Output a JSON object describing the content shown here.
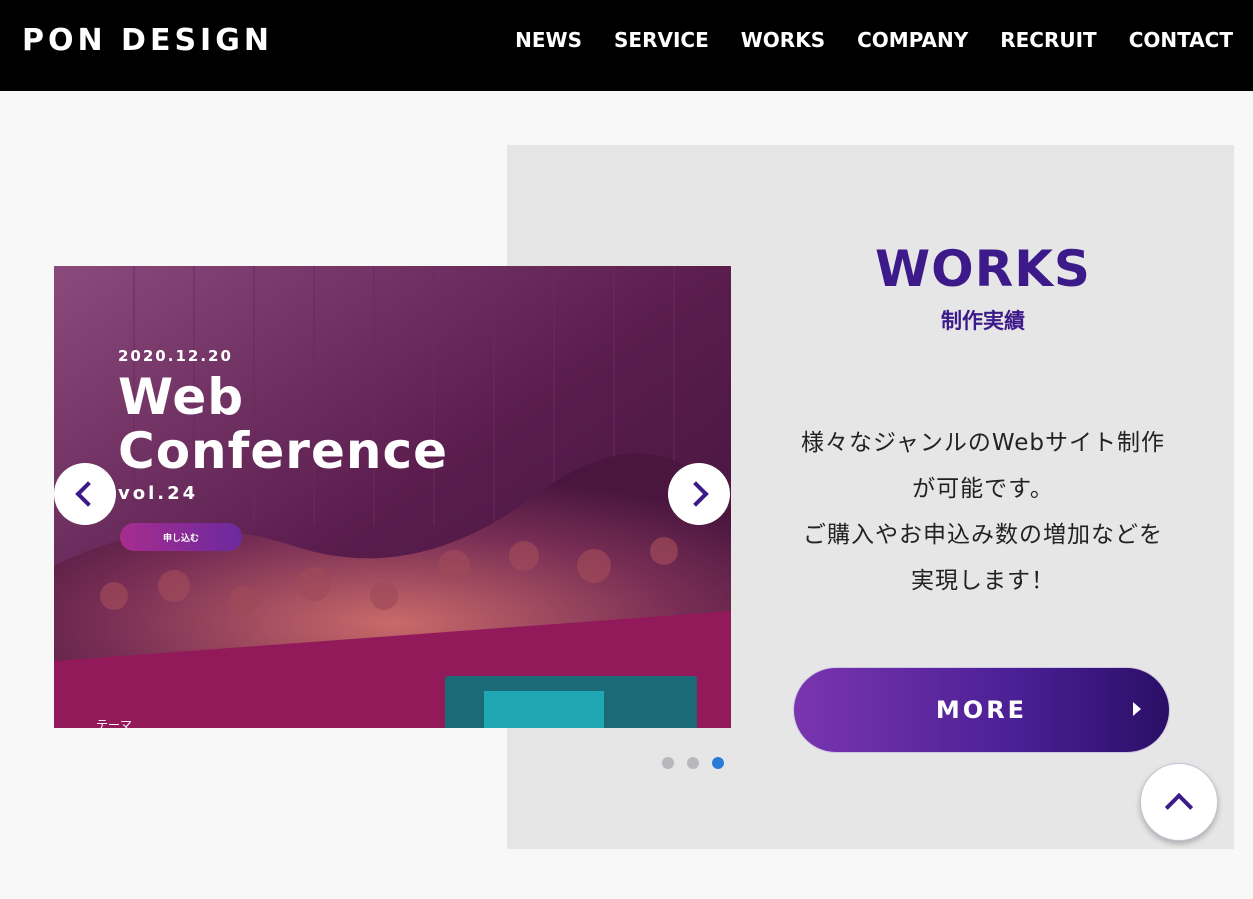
{
  "header": {
    "logo": "PON DESIGN",
    "nav": [
      "NEWS",
      "SERVICE",
      "WORKS",
      "COMPANY",
      "RECRUIT",
      "CONTACT"
    ]
  },
  "works": {
    "title": "WORKS",
    "subtitle": "制作実績",
    "desc_lines": [
      "様々なジャンルのWebサイト制作",
      "が可能です。",
      "ご購入やお申込み数の増加などを",
      "実現します！"
    ],
    "more_label": "MORE"
  },
  "slider": {
    "date": "2020.12.20",
    "title_lines": [
      "Web",
      "Conference"
    ],
    "vol": "vol.24",
    "apply_label": "申し込む",
    "theme_label": "テーマ",
    "dots_count": 3,
    "active_dot_index": 2
  },
  "colors": {
    "brand_purple": "#3c1a8a",
    "dot_active": "#2a7bd8",
    "header_bg": "#000000"
  },
  "icons": {
    "prev": "chevron-left-icon",
    "next": "chevron-right-icon",
    "more_arrow": "triangle-right-icon",
    "to_top": "chevron-up-icon"
  }
}
